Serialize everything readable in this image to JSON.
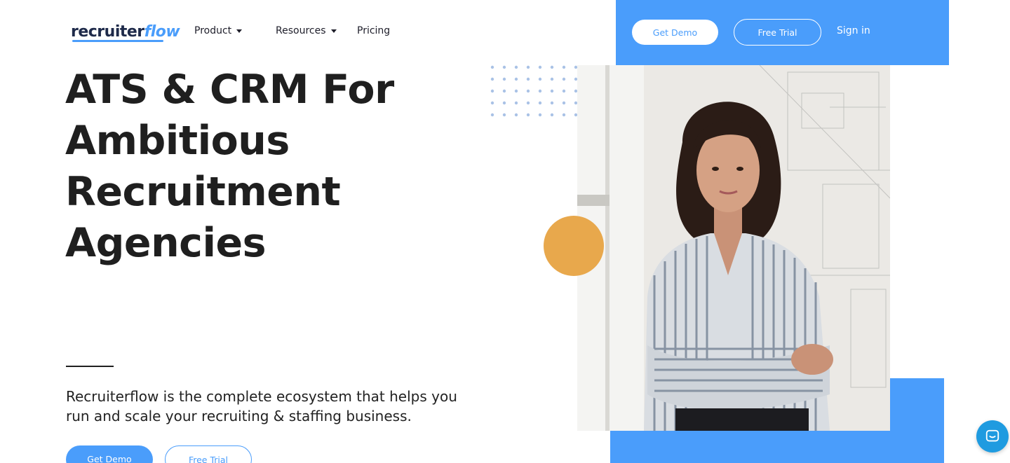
{
  "header": {
    "logo_main": "recruiter",
    "logo_accent": "flow",
    "nav": [
      {
        "label": "Product",
        "has_dropdown": true
      },
      {
        "label": "Resources",
        "has_dropdown": true
      },
      {
        "label": "Pricing",
        "has_dropdown": false
      }
    ],
    "get_demo_label": "Get Demo",
    "free_trial_label": "Free Trial",
    "sign_in_label": "Sign in"
  },
  "hero": {
    "title_lines": [
      "ATS & CRM For",
      "Ambitious",
      "Recruitment",
      "Agencies"
    ],
    "subtitle_line1": "Recruiterflow is the complete ecosystem that helps you",
    "subtitle_line2": "run and scale your recruiting & staffing business.",
    "get_demo_label": "Get Demo",
    "free_trial_label": "Free Trial"
  },
  "colors": {
    "accent_blue": "#4a9dfb",
    "accent_orange": "#e8a84c",
    "text_dark": "#1f1f1f"
  },
  "icons": {
    "chat": "chat-bubble-icon",
    "caret": "caret-down-icon"
  }
}
